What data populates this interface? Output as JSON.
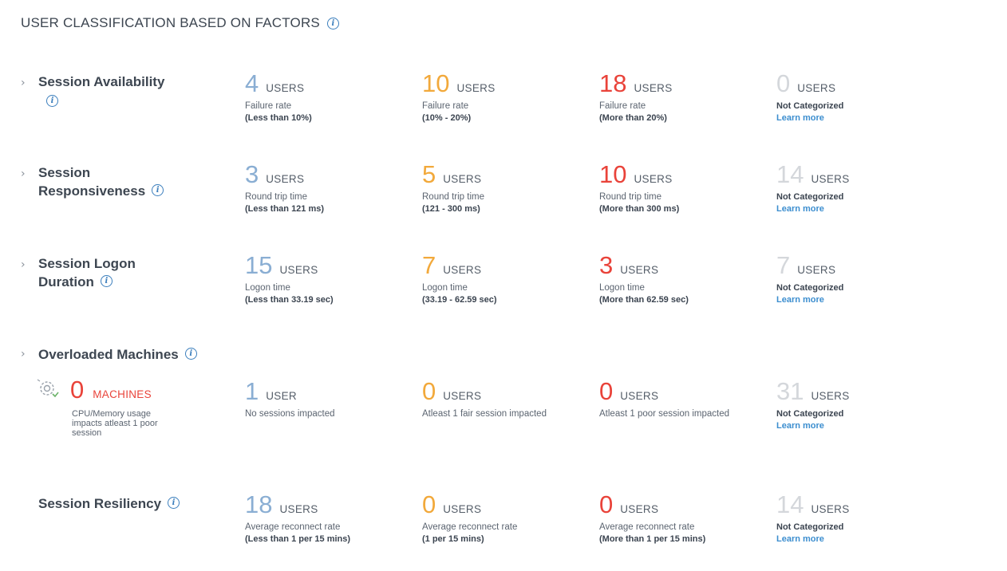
{
  "page": {
    "title": "USER CLASSIFICATION BASED ON FACTORS"
  },
  "units": {
    "users": "USERS",
    "user": "USER",
    "machines": "MACHINES"
  },
  "rows": [
    {
      "label_lines": [
        "Session Availability"
      ],
      "cells": [
        {
          "value": "4",
          "unit": "USERS",
          "line1": "Failure rate",
          "line2": "(Less than 10%)"
        },
        {
          "value": "10",
          "unit": "USERS",
          "line1": "Failure rate",
          "line2": "(10% - 20%)"
        },
        {
          "value": "18",
          "unit": "USERS",
          "line1": "Failure rate",
          "line2": "(More than 20%)"
        },
        {
          "value": "0",
          "unit": "USERS",
          "line1": "Not Categorized",
          "line2": "Learn more"
        }
      ]
    },
    {
      "label_lines": [
        "Session",
        "Responsiveness"
      ],
      "cells": [
        {
          "value": "3",
          "unit": "USERS",
          "line1": "Round trip time",
          "line2": "(Less than 121 ms)"
        },
        {
          "value": "5",
          "unit": "USERS",
          "line1": "Round trip time",
          "line2": "(121 - 300 ms)"
        },
        {
          "value": "10",
          "unit": "USERS",
          "line1": "Round trip time",
          "line2": "(More than 300 ms)"
        },
        {
          "value": "14",
          "unit": "USERS",
          "line1": "Not Categorized",
          "line2": "Learn more"
        }
      ]
    },
    {
      "label_lines": [
        "Session Logon",
        "Duration"
      ],
      "cells": [
        {
          "value": "15",
          "unit": "USERS",
          "line1": "Logon time",
          "line2": "(Less than 33.19 sec)"
        },
        {
          "value": "7",
          "unit": "USERS",
          "line1": "Logon time",
          "line2": "(33.19 - 62.59 sec)"
        },
        {
          "value": "3",
          "unit": "USERS",
          "line1": "Logon time",
          "line2": "(More than 62.59 sec)"
        },
        {
          "value": "7",
          "unit": "USERS",
          "line1": "Not Categorized",
          "line2": "Learn more"
        }
      ]
    },
    {
      "label_lines": [
        "Overloaded Machines"
      ],
      "machines": {
        "value": "0",
        "unit": "MACHINES",
        "desc": "CPU/Memory usage impacts atleast 1 poor session"
      },
      "cells": [
        {
          "value": "1",
          "unit": "USER",
          "line1": "No sessions impacted",
          "line2": ""
        },
        {
          "value": "0",
          "unit": "USERS",
          "line1": "Atleast 1 fair session impacted",
          "line2": ""
        },
        {
          "value": "0",
          "unit": "USERS",
          "line1": "Atleast 1 poor session impacted",
          "line2": ""
        },
        {
          "value": "31",
          "unit": "USERS",
          "line1": "Not Categorized",
          "line2": "Learn more"
        }
      ]
    },
    {
      "label_lines": [
        "Session Resiliency"
      ],
      "cells": [
        {
          "value": "18",
          "unit": "USERS",
          "line1": "Average reconnect rate",
          "line2": "(Less than 1 per 15 mins)"
        },
        {
          "value": "0",
          "unit": "USERS",
          "line1": "Average reconnect rate",
          "line2": "(1 per 15 mins)"
        },
        {
          "value": "0",
          "unit": "USERS",
          "line1": "Average reconnect rate",
          "line2": "(More than 1 per 15 mins)"
        },
        {
          "value": "14",
          "unit": "USERS",
          "line1": "Not Categorized",
          "line2": "Learn more"
        }
      ]
    }
  ],
  "colors": {
    "good": "#8aaed3",
    "fair": "#f2a93b",
    "poor": "#e9433a",
    "not_categorized": "#d4d7db",
    "link": "#3c8ecf"
  },
  "icons": {
    "expand": "chevron-right-icon",
    "info": "info-icon",
    "machine": "gear-machine-icon"
  }
}
